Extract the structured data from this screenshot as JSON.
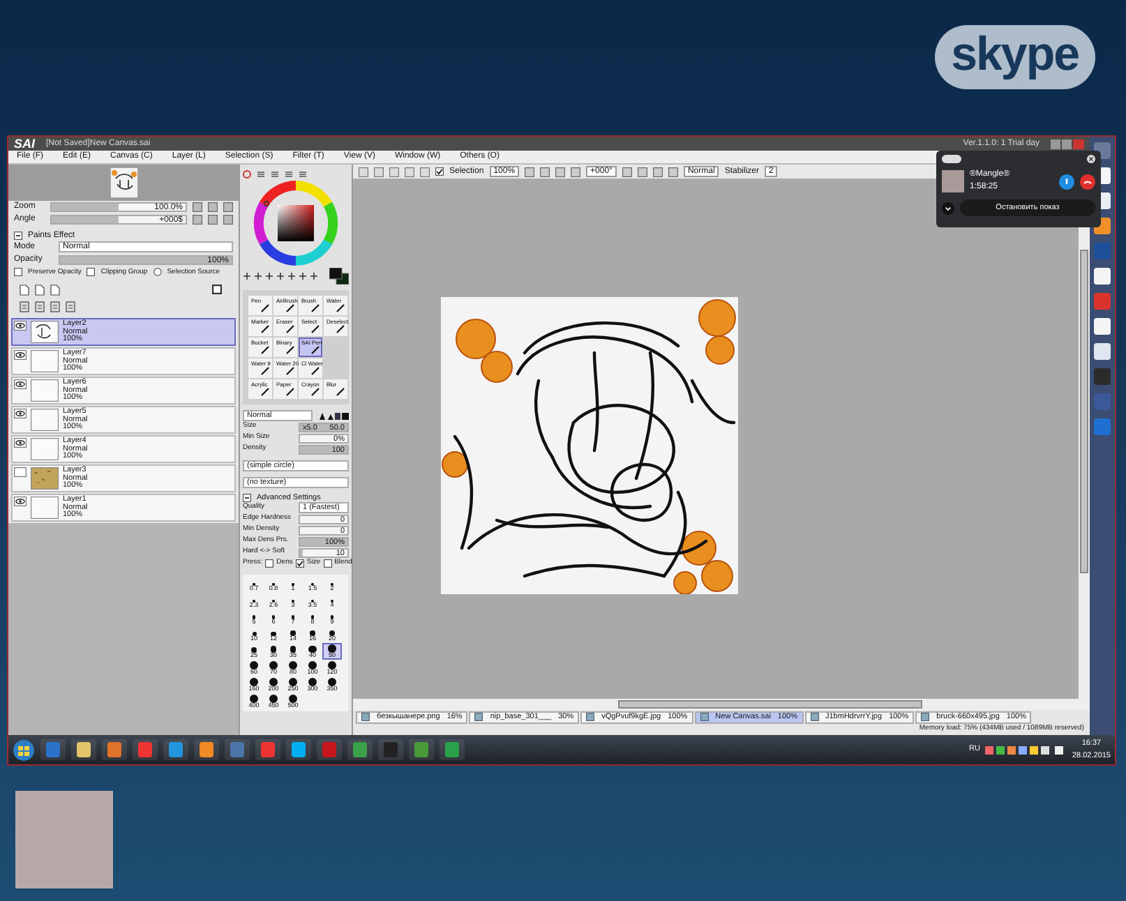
{
  "skype_logo": {
    "text": "skype"
  },
  "sai": {
    "logo": "SAI",
    "title": "[Not Saved]New Canvas.sai",
    "version": "Ver.1.1.0: 1 Trial day",
    "menu": [
      "File (F)",
      "Edit (E)",
      "Canvas (C)",
      "Layer (L)",
      "Selection (S)",
      "Filter (T)",
      "View (V)",
      "Window (W)",
      "Others (O)"
    ],
    "navigator": {
      "zoom": {
        "label": "Zoom",
        "value": "100.0%",
        "level": 0.5
      },
      "angle": {
        "label": "Angle",
        "value": "+000$",
        "level": 0.5
      }
    },
    "layer_panel": {
      "effect": "Paints Effect",
      "mode_label": "Mode",
      "mode_value": "Normal",
      "opacity": {
        "label": "Opacity",
        "value": "100%",
        "level": 1
      },
      "options": [
        {
          "label": "Preserve Opacity",
          "kind": "checkbox",
          "checked": false
        },
        {
          "label": "Clipping Group",
          "kind": "checkbox",
          "checked": false
        },
        {
          "label": "Selection Source",
          "kind": "radio",
          "checked": false
        }
      ],
      "layers": [
        {
          "name": "Layer2",
          "mode": "Normal",
          "opacity": "100%",
          "visible": true,
          "selected": true,
          "kind": "sketch"
        },
        {
          "name": "Layer7",
          "mode": "Normal",
          "opacity": "100%",
          "visible": true,
          "selected": false,
          "kind": "blank"
        },
        {
          "name": "Layer6",
          "mode": "Normal",
          "opacity": "100%",
          "visible": true,
          "selected": false,
          "kind": "blank"
        },
        {
          "name": "Layer5",
          "mode": "Normal",
          "opacity": "100%",
          "visible": true,
          "selected": false,
          "kind": "blank"
        },
        {
          "name": "Layer4",
          "mode": "Normal",
          "opacity": "100%",
          "visible": true,
          "selected": false,
          "kind": "blank"
        },
        {
          "name": "Layer3",
          "mode": "Normal",
          "opacity": "100%",
          "visible": false,
          "selected": false,
          "kind": "texture"
        },
        {
          "name": "Layer1",
          "mode": "Normal",
          "opacity": "100%",
          "visible": true,
          "selected": false,
          "kind": "blank"
        }
      ]
    },
    "brush_rows": [
      [
        {
          "label": "Pen",
          "selected": false
        },
        {
          "label": "AirBrush",
          "selected": false
        },
        {
          "label": "Brush",
          "selected": false
        },
        {
          "label": "Water",
          "selected": false
        }
      ],
      [
        {
          "label": "Marker",
          "selected": false
        },
        {
          "label": "Eraser",
          "selected": false
        },
        {
          "label": "Select",
          "selected": false
        },
        {
          "label": "Deselect",
          "selected": false
        }
      ],
      [
        {
          "label": "Bucket",
          "selected": false
        },
        {
          "label": "Binary",
          "selected": false
        },
        {
          "label": "SAI Pen",
          "selected": true
        }
      ],
      [
        {
          "label": "Water 9",
          "selected": false
        },
        {
          "label": "Water 20",
          "selected": false
        },
        {
          "label": "Cl Water",
          "selected": false
        }
      ],
      [
        {
          "label": "Acrylic",
          "selected": false
        },
        {
          "label": "Paper",
          "selected": false
        },
        {
          "label": "Crayon",
          "selected": false
        },
        {
          "label": "Blur",
          "selected": false
        }
      ]
    ],
    "brush_settings": {
      "blend": "Normal",
      "size": {
        "label": "Size",
        "factor": "x5.0",
        "value": "50.0",
        "level": 1
      },
      "min_size": {
        "label": "Min Size",
        "value": "0%",
        "level": 0
      },
      "density": {
        "label": "Density",
        "value": "100",
        "level": 1
      },
      "shape": "(simple circle)",
      "texture": "(no texture)",
      "advanced": "Advanced Settings",
      "quality_label": "Quality",
      "quality_value": "1 (Fastest)",
      "edge": {
        "label": "Edge Hardness",
        "value": "0",
        "level": 0
      },
      "min_density": {
        "label": "Min Density",
        "value": "0",
        "level": 0
      },
      "max_density": {
        "label": "Max Dens Prs.",
        "value": "100%",
        "level": 1
      },
      "hard_soft": {
        "label": "Hard <-> Soft",
        "value": "10",
        "level": 0.05
      },
      "press_label": "Press:",
      "press_options": [
        {
          "label": "Dens",
          "checked": false
        },
        {
          "label": "Size",
          "checked": true
        },
        {
          "label": "Blend",
          "checked": false
        }
      ]
    },
    "sizes": [
      {
        "label": "0.7",
        "selected": false
      },
      {
        "label": "0.8",
        "selected": false
      },
      {
        "label": "1",
        "selected": false
      },
      {
        "label": "1.5",
        "selected": false
      },
      {
        "label": "2",
        "selected": false
      },
      {
        "label": "2.3",
        "selected": false
      },
      {
        "label": "2.6",
        "selected": false
      },
      {
        "label": "3",
        "selected": false
      },
      {
        "label": "3.5",
        "selected": false
      },
      {
        "label": "4",
        "selected": false
      },
      {
        "label": "5",
        "selected": false
      },
      {
        "label": "6",
        "selected": false
      },
      {
        "label": "7",
        "selected": false
      },
      {
        "label": "8",
        "selected": false
      },
      {
        "label": "9",
        "selected": false
      },
      {
        "label": "10",
        "selected": false
      },
      {
        "label": "12",
        "selected": false
      },
      {
        "label": "14",
        "selected": false
      },
      {
        "label": "16",
        "selected": false
      },
      {
        "label": "20",
        "selected": false
      },
      {
        "label": "25",
        "selected": false
      },
      {
        "label": "30",
        "selected": false
      },
      {
        "label": "35",
        "selected": false
      },
      {
        "label": "40",
        "selected": false
      },
      {
        "label": "50",
        "selected": true
      },
      {
        "label": "60",
        "selected": false
      },
      {
        "label": "70",
        "selected": false
      },
      {
        "label": "80",
        "selected": false
      },
      {
        "label": "100",
        "selected": false
      },
      {
        "label": "120",
        "selected": false
      },
      {
        "label": "160",
        "selected": false
      },
      {
        "label": "200",
        "selected": false
      },
      {
        "label": "250",
        "selected": false
      },
      {
        "label": "300",
        "selected": false
      },
      {
        "label": "350",
        "selected": false
      },
      {
        "label": "400",
        "selected": false
      },
      {
        "label": "450",
        "selected": false
      },
      {
        "label": "500",
        "selected": false
      }
    ],
    "toolbar": {
      "selection_label": "Selection",
      "selection_checked": true,
      "zoom": "100%",
      "angle": "+000°",
      "blend": "Normal",
      "stabilizer_label": "Stabilizer",
      "stabilizer_value": "2"
    },
    "tabs": [
      {
        "name": "безкышанере.png",
        "zoom": "16%",
        "selected": false
      },
      {
        "name": "nip_base_301___",
        "zoom": "30%",
        "selected": false
      },
      {
        "name": "vQgPvuf9kgE.jpg",
        "zoom": "100%",
        "selected": false
      },
      {
        "name": "New Canvas.sai",
        "zoom": "100%",
        "selected": true
      },
      {
        "name": "J1bmHdrvrrY.jpg",
        "zoom": "100%",
        "selected": false
      },
      {
        "name": "bruck-660x495.jpg",
        "zoom": "100%",
        "selected": false
      }
    ],
    "status": "Memory load: 75% (434MB used / 1089MB reserved)"
  },
  "skype_call": {
    "caller": "®Mangle®",
    "duration": "1:58:25",
    "stop_button": "Остановить показ"
  },
  "taskbar": {
    "language": "RU",
    "time": "16:37",
    "date": "28.02.2015"
  }
}
